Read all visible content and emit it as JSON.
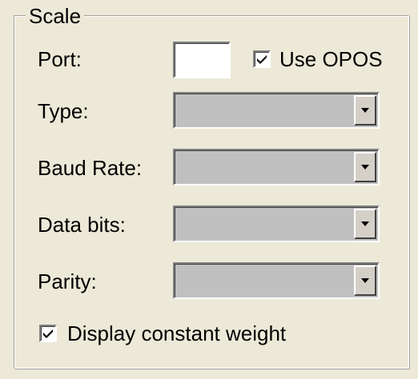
{
  "group": {
    "title": "Scale"
  },
  "port": {
    "label": "Port:",
    "value": "",
    "use_opos": {
      "label": "Use OPOS",
      "checked": true
    }
  },
  "fields": [
    {
      "label": "Type:",
      "value": "",
      "icon": "chevron-down-icon"
    },
    {
      "label": "Baud Rate:",
      "value": "",
      "icon": "chevron-down-icon"
    },
    {
      "label": "Data bits:",
      "value": "",
      "icon": "chevron-down-icon"
    },
    {
      "label": "Parity:",
      "value": "",
      "icon": "chevron-down-icon"
    }
  ],
  "display_constant_weight": {
    "label": "Display constant weight",
    "checked": true
  },
  "colors": {
    "dialog_background": "#ece9d8",
    "disabled_select": "#c0c0c0"
  }
}
